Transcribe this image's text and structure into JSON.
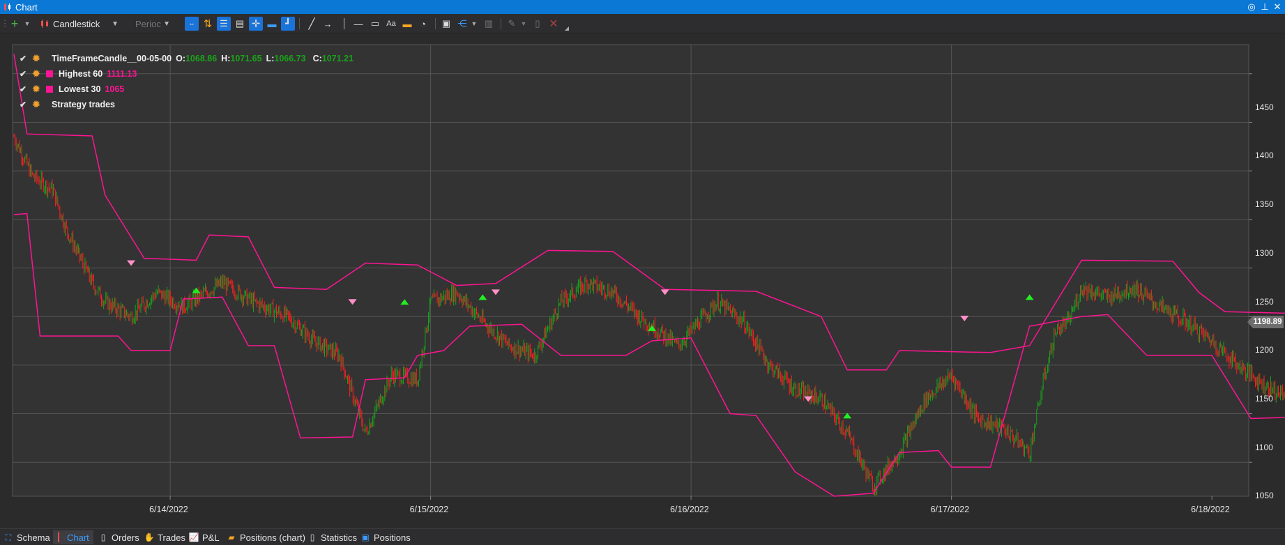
{
  "window": {
    "title": "Chart"
  },
  "toolbar": {
    "style_select": "Candlestick",
    "period_select": "Perioc"
  },
  "legend": [
    {
      "name": "TimeFrameCandle__00-05-00",
      "o_label": "O:",
      "o": "1068.86",
      "h_label": "H:",
      "h": "1071.65",
      "l_label": "L:",
      "l": "1066.73",
      "c_label": "C:",
      "c": "1071.21"
    },
    {
      "name": "Highest 60",
      "value": "1111.13"
    },
    {
      "name": "Lowest 30",
      "value": "1065"
    },
    {
      "name": "Strategy trades"
    }
  ],
  "last_price": "1198.89",
  "colors": {
    "up": "#1aa31a",
    "down": "#ff1f1f",
    "indicator": "#ff1493",
    "buy_marker": "#22ee22",
    "sell_marker": "#ff8fc8"
  },
  "chart_data": {
    "type": "line",
    "yticks": [
      "1450",
      "1400",
      "1350",
      "1300",
      "1250",
      "1200",
      "1150",
      "1100",
      "1050"
    ],
    "xticks": [
      "6/14/2022",
      "6/15/2022",
      "6/16/2022",
      "6/17/2022",
      "6/18/2022"
    ],
    "ylim": [
      1015,
      1480
    ],
    "price": [
      [
        0,
        1385
      ],
      [
        0.07,
        1345
      ],
      [
        0.15,
        1330
      ],
      [
        0.2,
        1290
      ],
      [
        0.3,
        1235
      ],
      [
        0.35,
        1215
      ],
      [
        0.45,
        1200
      ],
      [
        0.55,
        1225
      ],
      [
        0.65,
        1210
      ],
      [
        0.8,
        1235
      ],
      [
        0.92,
        1215
      ],
      [
        1.05,
        1200
      ],
      [
        1.15,
        1175
      ],
      [
        1.25,
        1160
      ],
      [
        1.3,
        1120
      ],
      [
        1.35,
        1080
      ],
      [
        1.45,
        1140
      ],
      [
        1.55,
        1135
      ],
      [
        1.6,
        1215
      ],
      [
        1.7,
        1225
      ],
      [
        1.8,
        1195
      ],
      [
        1.9,
        1170
      ],
      [
        2.0,
        1160
      ],
      [
        2.1,
        1215
      ],
      [
        2.2,
        1235
      ],
      [
        2.3,
        1225
      ],
      [
        2.4,
        1200
      ],
      [
        2.55,
        1170
      ],
      [
        2.7,
        1215
      ],
      [
        2.8,
        1195
      ],
      [
        2.9,
        1150
      ],
      [
        3.0,
        1125
      ],
      [
        3.1,
        1115
      ],
      [
        3.2,
        1080
      ],
      [
        3.3,
        1025
      ],
      [
        3.4,
        1060
      ],
      [
        3.5,
        1115
      ],
      [
        3.6,
        1140
      ],
      [
        3.7,
        1095
      ],
      [
        3.8,
        1085
      ],
      [
        3.9,
        1060
      ],
      [
        3.95,
        1130
      ],
      [
        4.0,
        1185
      ],
      [
        4.05,
        1195
      ],
      [
        4.1,
        1230
      ],
      [
        4.2,
        1220
      ],
      [
        4.3,
        1230
      ],
      [
        4.4,
        1210
      ],
      [
        4.5,
        1195
      ],
      [
        4.6,
        1175
      ],
      [
        4.7,
        1150
      ],
      [
        4.8,
        1130
      ],
      [
        4.9,
        1115
      ],
      [
        5.0,
        1120
      ],
      [
        5.1,
        1100
      ],
      [
        5.2,
        1085
      ],
      [
        5.3,
        1075
      ],
      [
        5.4,
        1100
      ],
      [
        5.5,
        1110
      ],
      [
        5.6,
        1095
      ],
      [
        5.7,
        1100
      ],
      [
        5.8,
        1085
      ],
      [
        5.9,
        1080
      ],
      [
        6.0,
        1080
      ],
      [
        6.1,
        1090
      ]
    ],
    "highest": [
      [
        0,
        1470
      ],
      [
        0.05,
        1388
      ],
      [
        0.3,
        1386
      ],
      [
        0.35,
        1325
      ],
      [
        0.5,
        1260
      ],
      [
        0.7,
        1258
      ],
      [
        0.75,
        1284
      ],
      [
        0.9,
        1282
      ],
      [
        1.0,
        1230
      ],
      [
        1.2,
        1228
      ],
      [
        1.35,
        1255
      ],
      [
        1.55,
        1253
      ],
      [
        1.7,
        1232
      ],
      [
        1.85,
        1234
      ],
      [
        2.05,
        1268
      ],
      [
        2.3,
        1267
      ],
      [
        2.5,
        1228
      ],
      [
        2.85,
        1226
      ],
      [
        3.1,
        1200
      ],
      [
        3.2,
        1145
      ],
      [
        3.35,
        1145
      ],
      [
        3.4,
        1165
      ],
      [
        3.75,
        1163
      ],
      [
        3.9,
        1170
      ],
      [
        4.1,
        1258
      ],
      [
        4.45,
        1257
      ],
      [
        4.55,
        1225
      ],
      [
        4.65,
        1205
      ],
      [
        4.95,
        1203
      ],
      [
        5.05,
        1155
      ],
      [
        5.35,
        1153
      ],
      [
        5.45,
        1135
      ],
      [
        5.75,
        1133
      ],
      [
        5.85,
        1115
      ],
      [
        6.1,
        1113
      ]
    ],
    "lowest": [
      [
        0,
        1305
      ],
      [
        0.05,
        1306
      ],
      [
        0.1,
        1180
      ],
      [
        0.4,
        1180
      ],
      [
        0.45,
        1165
      ],
      [
        0.6,
        1165
      ],
      [
        0.65,
        1218
      ],
      [
        0.8,
        1220
      ],
      [
        0.9,
        1170
      ],
      [
        1.0,
        1170
      ],
      [
        1.1,
        1075
      ],
      [
        1.3,
        1076
      ],
      [
        1.35,
        1135
      ],
      [
        1.5,
        1137
      ],
      [
        1.55,
        1160
      ],
      [
        1.65,
        1165
      ],
      [
        1.75,
        1190
      ],
      [
        1.95,
        1192
      ],
      [
        2.1,
        1160
      ],
      [
        2.35,
        1160
      ],
      [
        2.45,
        1175
      ],
      [
        2.6,
        1178
      ],
      [
        2.75,
        1100
      ],
      [
        2.85,
        1098
      ],
      [
        3.0,
        1040
      ],
      [
        3.15,
        1015
      ],
      [
        3.3,
        1018
      ],
      [
        3.4,
        1060
      ],
      [
        3.55,
        1062
      ],
      [
        3.6,
        1045
      ],
      [
        3.75,
        1045
      ],
      [
        3.9,
        1190
      ],
      [
        4.1,
        1200
      ],
      [
        4.2,
        1202
      ],
      [
        4.35,
        1160
      ],
      [
        4.6,
        1160
      ],
      [
        4.75,
        1095
      ],
      [
        5.0,
        1097
      ],
      [
        5.1,
        1080
      ],
      [
        5.25,
        1082
      ],
      [
        5.35,
        1050
      ],
      [
        5.45,
        1052
      ],
      [
        5.6,
        1078
      ],
      [
        5.75,
        1080
      ],
      [
        5.9,
        1068
      ],
      [
        6.1,
        1072
      ]
    ],
    "buys": [
      [
        0.7,
        1227
      ],
      [
        1.5,
        1215
      ],
      [
        1.8,
        1220
      ],
      [
        2.45,
        1188
      ],
      [
        3.2,
        1098
      ],
      [
        3.9,
        1220
      ],
      [
        5.0,
        1093
      ]
    ],
    "sells": [
      [
        0.45,
        1255
      ],
      [
        1.3,
        1215
      ],
      [
        1.85,
        1225
      ],
      [
        2.5,
        1225
      ],
      [
        3.05,
        1115
      ],
      [
        3.65,
        1198
      ],
      [
        5.65,
        1112
      ],
      [
        5.75,
        1095
      ]
    ]
  }
}
